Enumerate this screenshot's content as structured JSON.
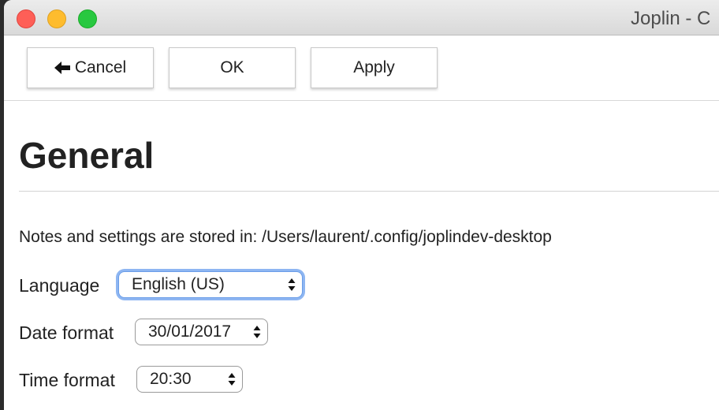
{
  "window": {
    "title": "Joplin - C"
  },
  "toolbar": {
    "cancel_label": "Cancel",
    "ok_label": "OK",
    "apply_label": "Apply"
  },
  "section": {
    "title": "General",
    "storage_info": "Notes and settings are stored in: /Users/laurent/.config/joplindev-desktop"
  },
  "settings": {
    "language": {
      "label": "Language",
      "value": "English (US)"
    },
    "date_format": {
      "label": "Date format",
      "value": "30/01/2017"
    },
    "time_format": {
      "label": "Time format",
      "value": "20:30"
    }
  },
  "colors": {
    "focus_ring": "#8eb6f2",
    "close": "#fe5f57",
    "minimize": "#febc2e",
    "maximize": "#28c840"
  },
  "icons": {
    "cancel": "arrow-left-icon",
    "select_arrows": "updown-icon"
  }
}
